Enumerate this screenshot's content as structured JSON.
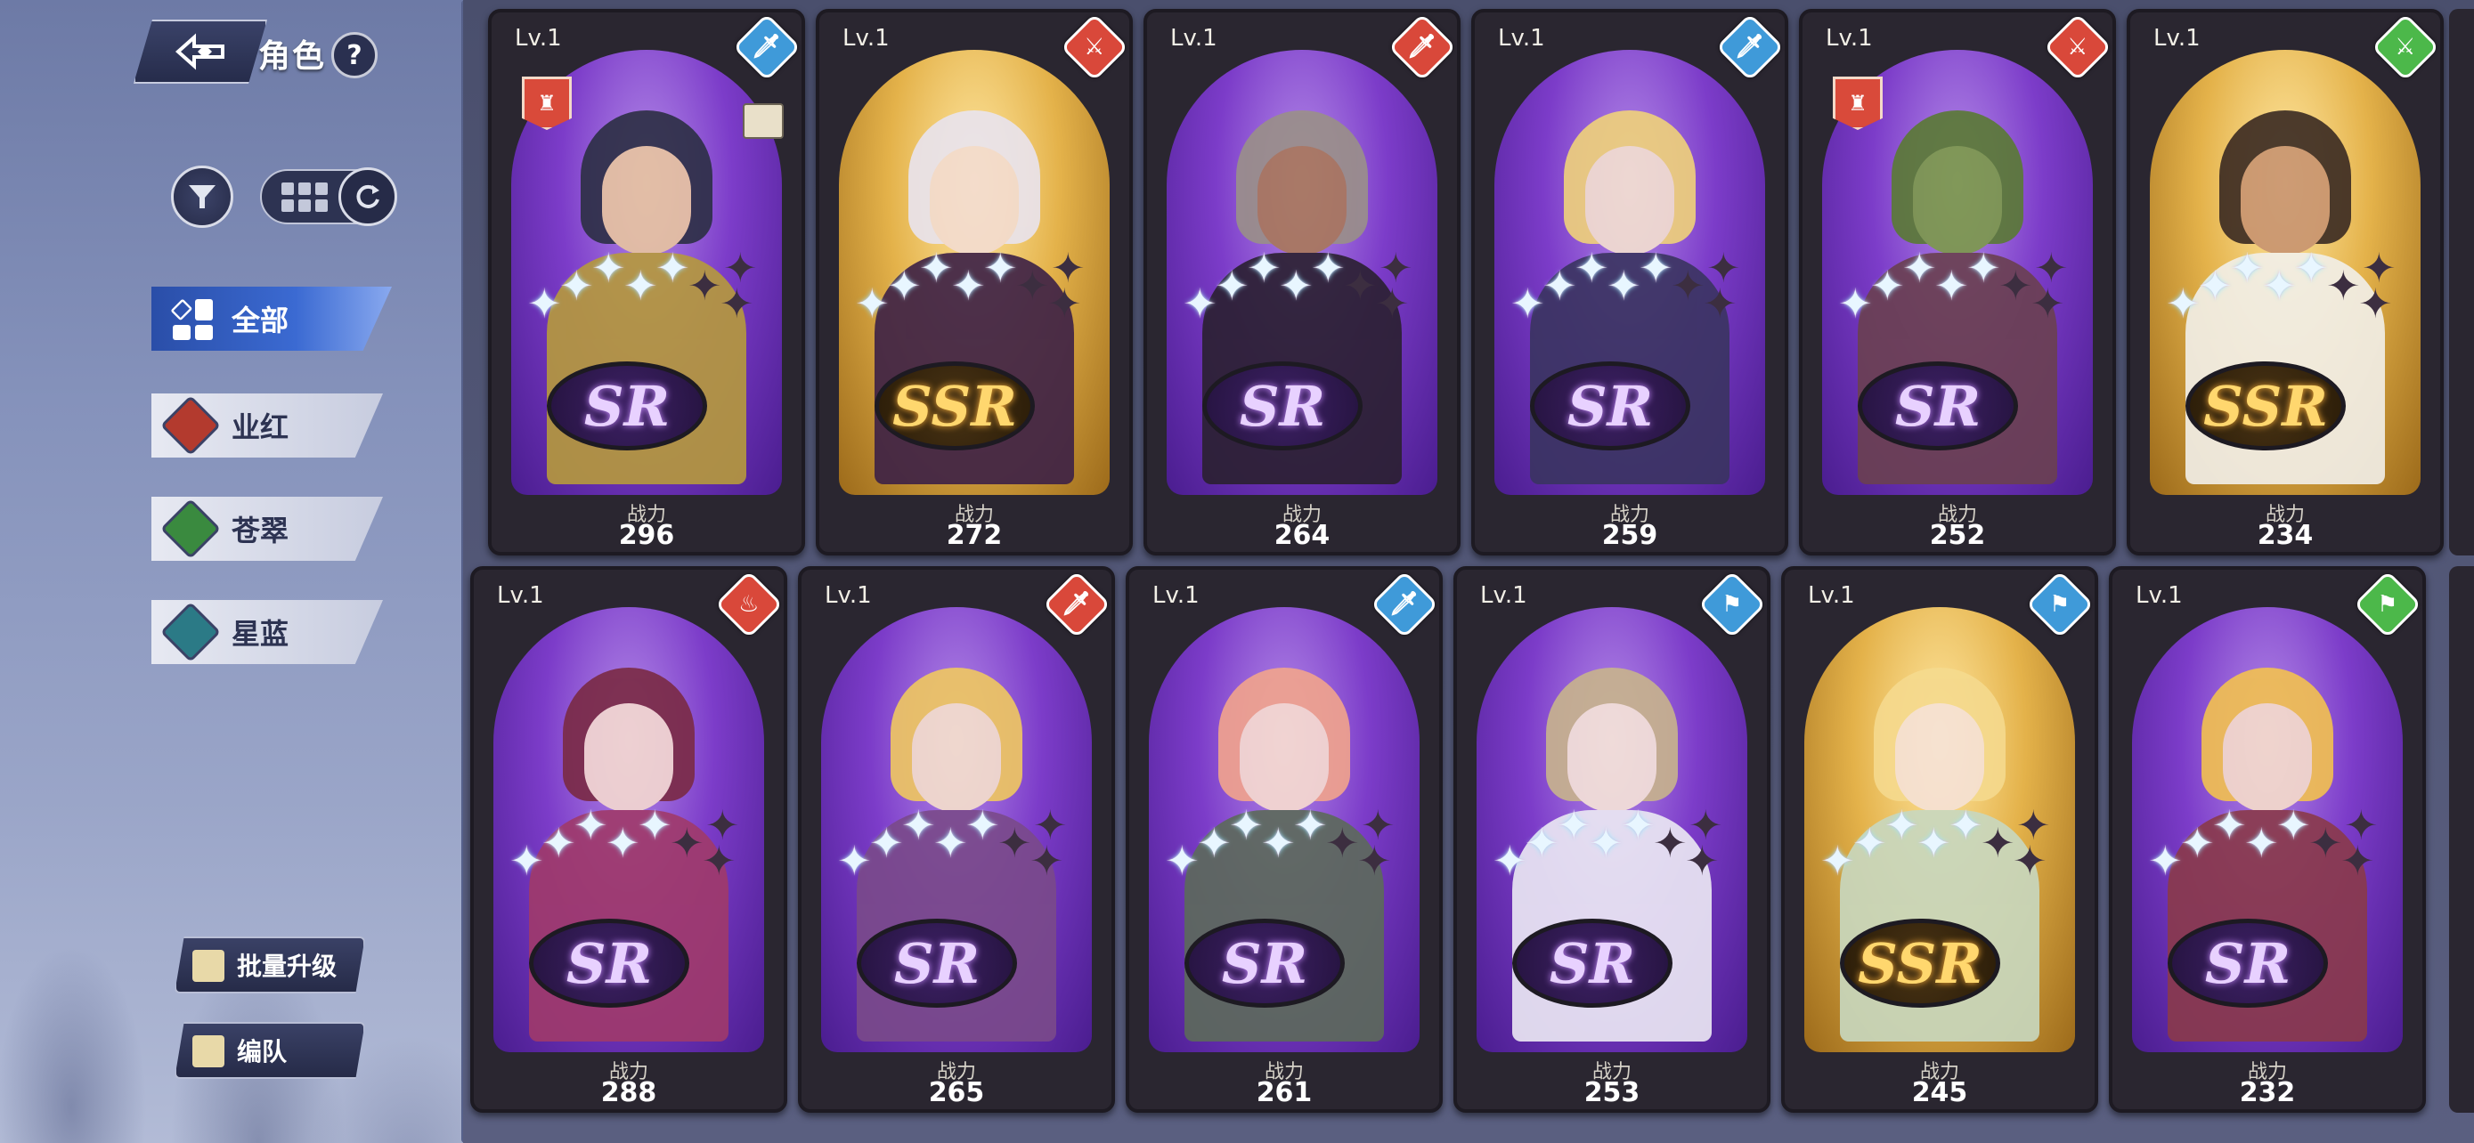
{
  "header": {
    "title": "角色",
    "help": "?"
  },
  "categories": [
    {
      "label": "全部",
      "active": true,
      "color": "#3b6ad2"
    },
    {
      "label": "业红",
      "active": false,
      "color": "#b33a2e"
    },
    {
      "label": "苍翠",
      "active": false,
      "color": "#3a8a3f"
    },
    {
      "label": "星蓝",
      "active": false,
      "color": "#2b7a86"
    }
  ],
  "buttons": {
    "batch_upgrade": "批量升级",
    "formation": "编队"
  },
  "power_label": "战力",
  "cards": [
    {
      "level": "Lv.1",
      "rarity": "SR",
      "power": "296",
      "element": "blue",
      "stars": 3,
      "icon": "dagger-icon"
    },
    {
      "level": "Lv.1",
      "rarity": "SSR",
      "power": "272",
      "element": "red",
      "stars": 3,
      "icon": "sword-icon"
    },
    {
      "level": "Lv.1",
      "rarity": "SR",
      "power": "264",
      "element": "red",
      "stars": 3,
      "icon": "dagger-icon"
    },
    {
      "level": "Lv.1",
      "rarity": "SR",
      "power": "259",
      "element": "blue",
      "stars": 3,
      "icon": "dagger-icon"
    },
    {
      "level": "Lv.1",
      "rarity": "SR",
      "power": "252",
      "element": "red",
      "stars": 3,
      "icon": "sword-icon"
    },
    {
      "level": "Lv.1",
      "rarity": "SSR",
      "power": "234",
      "element": "green",
      "stars": 3,
      "icon": "sword-icon"
    },
    {
      "level": "Lv.1",
      "rarity": "SR",
      "power": "288",
      "element": "red",
      "stars": 3,
      "icon": "flame-icon"
    },
    {
      "level": "Lv.1",
      "rarity": "SR",
      "power": "265",
      "element": "red",
      "stars": 3,
      "icon": "dagger-icon"
    },
    {
      "level": "Lv.1",
      "rarity": "SR",
      "power": "261",
      "element": "blue",
      "stars": 3,
      "icon": "dagger-icon"
    },
    {
      "level": "Lv.1",
      "rarity": "SR",
      "power": "253",
      "element": "blue",
      "stars": 3,
      "icon": "runner-icon"
    },
    {
      "level": "Lv.1",
      "rarity": "SSR",
      "power": "245",
      "element": "blue",
      "stars": 3,
      "icon": "runner-icon"
    },
    {
      "level": "Lv.1",
      "rarity": "SR",
      "power": "232",
      "element": "green",
      "stars": 3,
      "icon": "runner-icon"
    }
  ],
  "colors": {
    "red": "#d9483a",
    "blue": "#3f9ad9",
    "green": "#4cb84a",
    "sr_arch": "#7c3cc9",
    "ssr_arch": "#e4b24a"
  }
}
